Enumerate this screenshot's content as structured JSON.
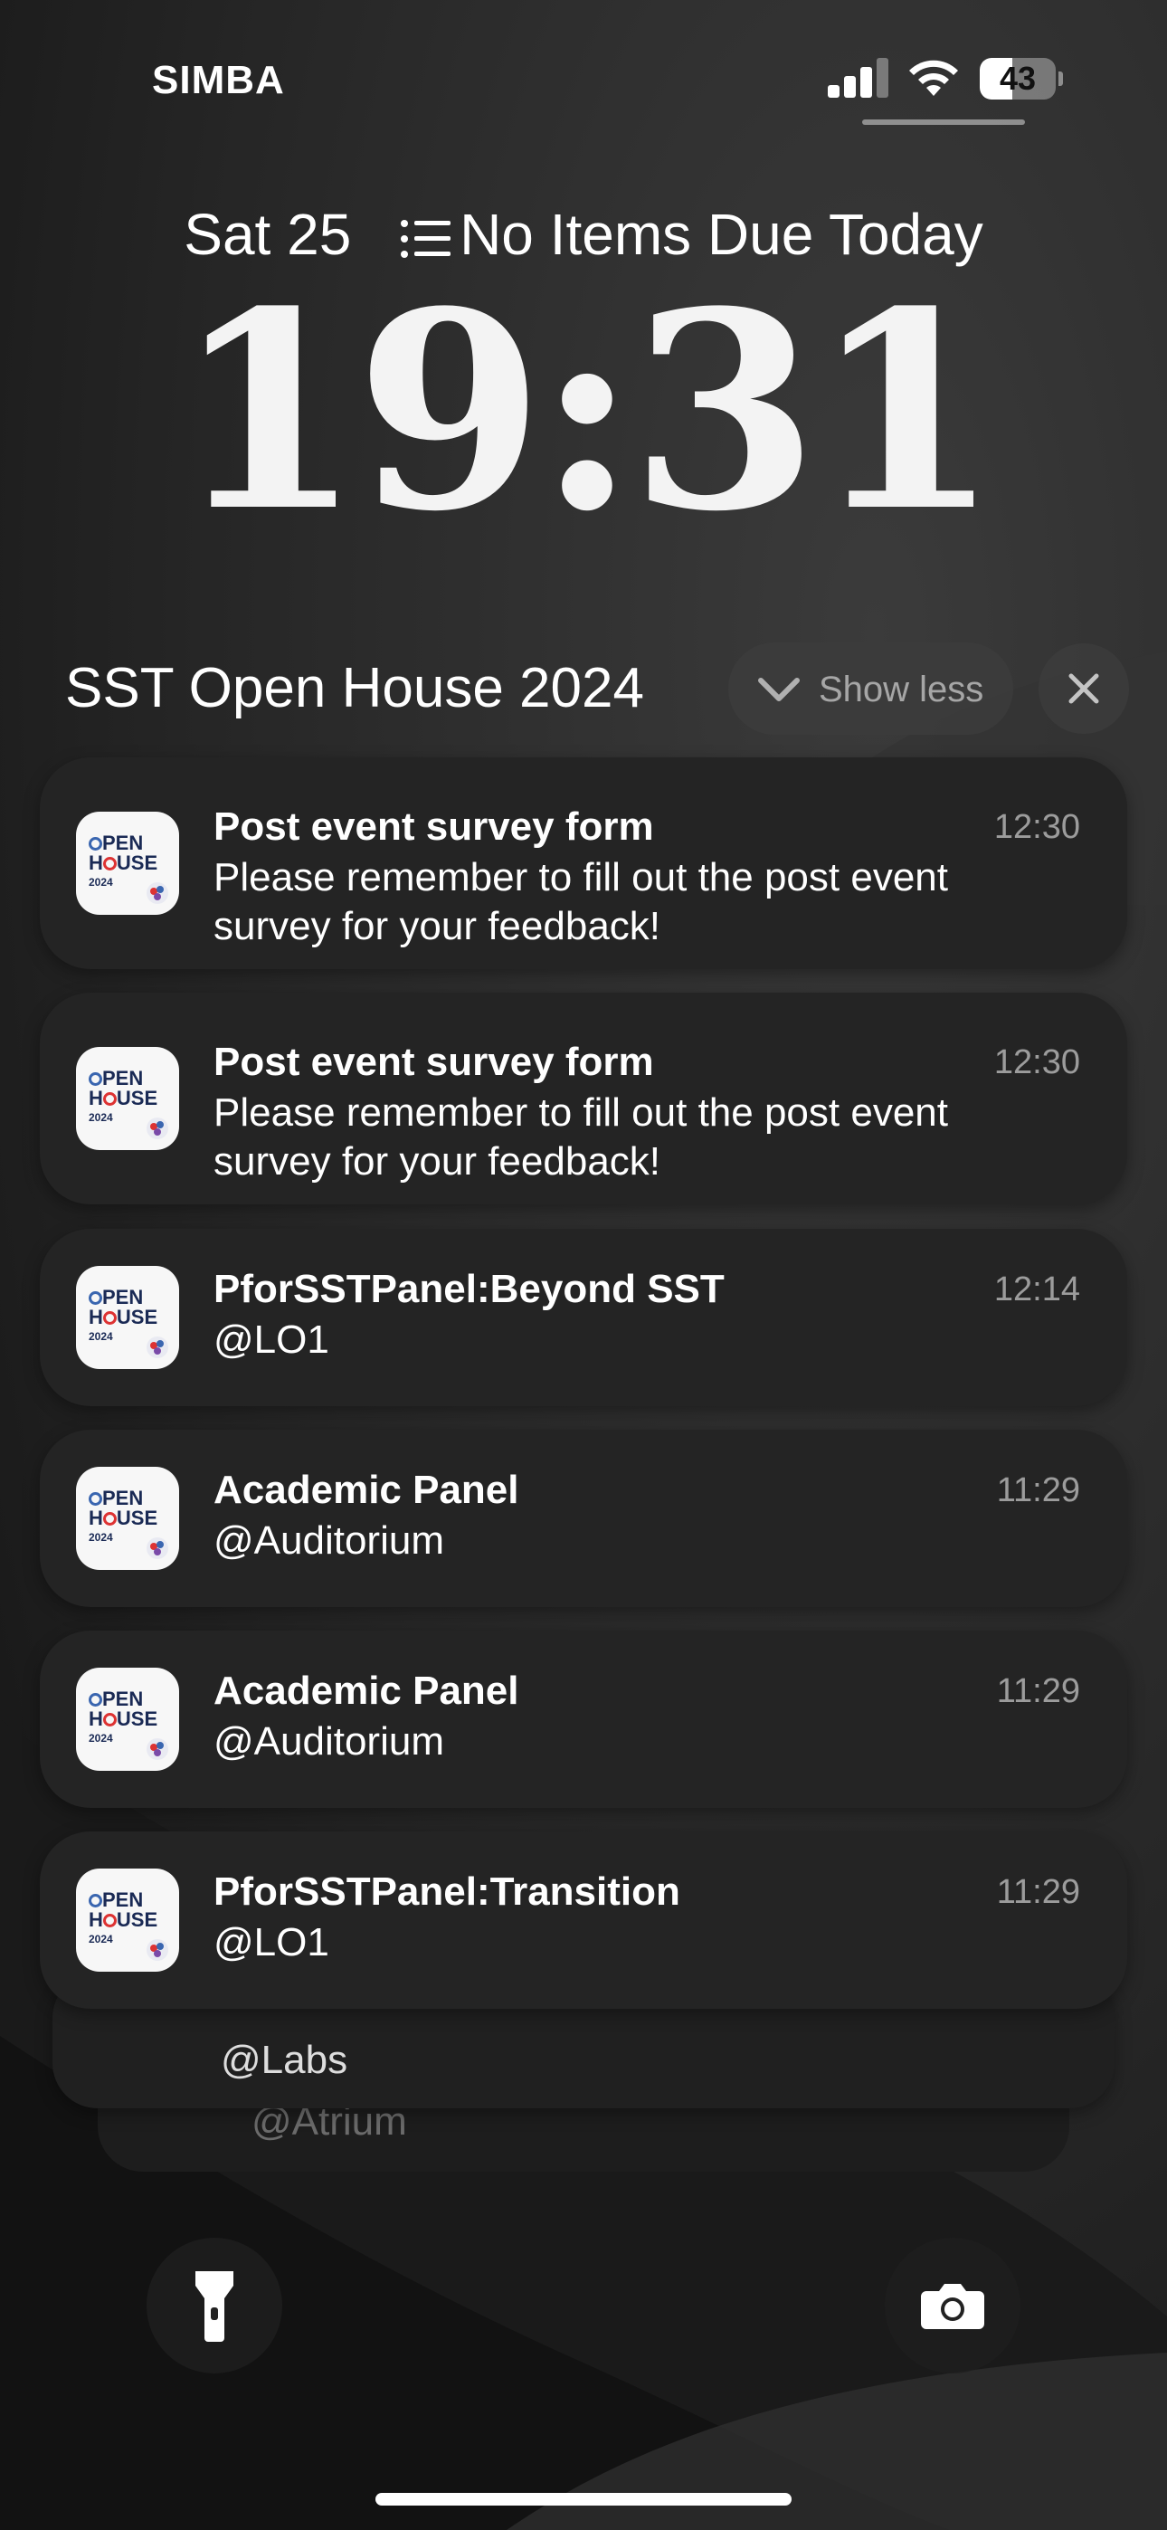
{
  "status_bar": {
    "carrier": "SIMBA",
    "battery_level": "43",
    "battery_fraction": 0.43,
    "signal_bars_active": 3,
    "signal_bars_total": 4
  },
  "lock_screen": {
    "date": "Sat 25",
    "reminder_text": "No Items Due Today",
    "time": "19:31"
  },
  "group": {
    "title": "SST Open House 2024",
    "show_less_label": "Show less"
  },
  "notifications": [
    {
      "title": "Post event survey form",
      "body": "Please remember to fill out the post event survey for your feedback!",
      "time": "12:30"
    },
    {
      "title": "Post event survey form",
      "body": "Please remember to fill out the post event survey for your feedback!",
      "time": "12:30"
    },
    {
      "title": "PforSSTPanel:Beyond SST",
      "body": "@LO1",
      "time": "12:14"
    },
    {
      "title": "Academic Panel",
      "body": "@Auditorium",
      "time": "11:29"
    },
    {
      "title": "Academic Panel",
      "body": "@Auditorium",
      "time": "11:29"
    },
    {
      "title": "PforSSTPanel:Transition",
      "body": "@LO1",
      "time": "11:29"
    }
  ],
  "stacked_notifications": [
    {
      "body": "@Labs"
    },
    {
      "body": "@Atrium"
    }
  ],
  "app_icon": {
    "line1": "PEN",
    "line2a": "H",
    "line2b": "USE",
    "line3": "2024"
  },
  "colors": {
    "card_background": "#242424",
    "secondary_text": "rgba(255,255,255,0.55)",
    "app_icon_blue": "#3a66b0",
    "app_icon_red": "#d33"
  },
  "icons": {
    "list": "list-icon",
    "chevron": "chevron-down-icon",
    "close": "close-icon",
    "flashlight": "flashlight-icon",
    "camera": "camera-icon",
    "wifi": "wifi-icon",
    "signal": "signal-icon"
  }
}
